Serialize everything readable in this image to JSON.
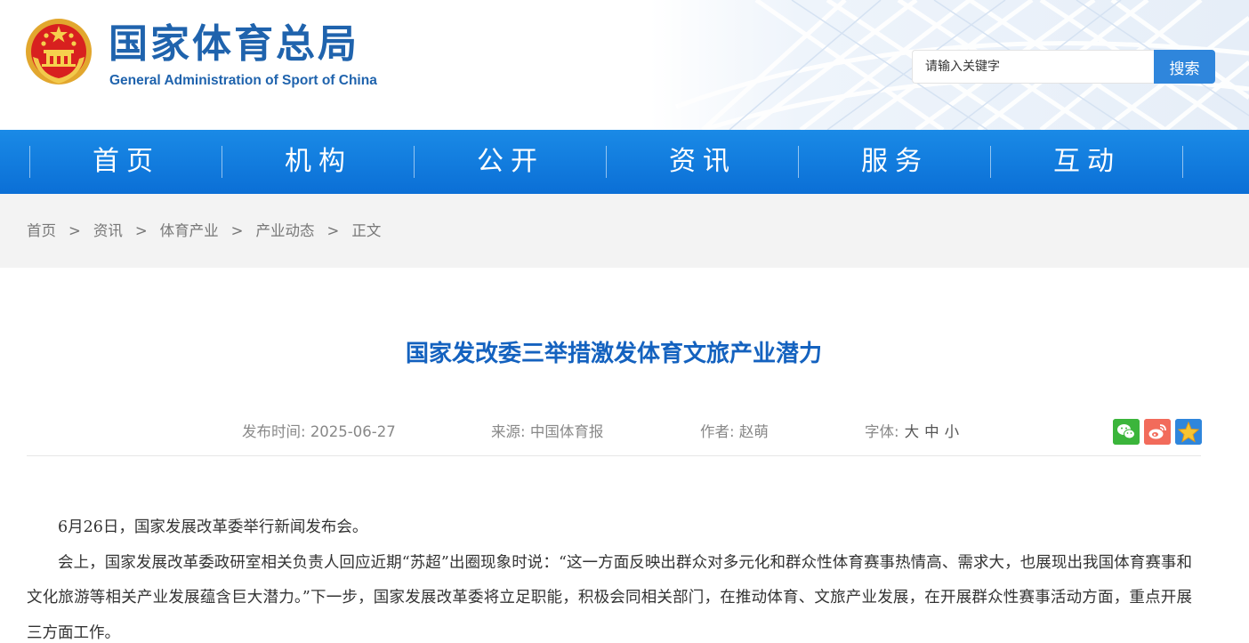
{
  "header": {
    "logo_cn": "国家体育总局",
    "logo_en": "General Administration of Sport of China",
    "search_placeholder": "请输入关键字",
    "search_button": "搜索"
  },
  "nav": {
    "items": [
      {
        "label": "首页"
      },
      {
        "label": "机构"
      },
      {
        "label": "公开"
      },
      {
        "label": "资讯"
      },
      {
        "label": "服务"
      },
      {
        "label": "互动"
      }
    ]
  },
  "breadcrumb": {
    "items": [
      "首页",
      "资讯",
      "体育产业",
      "产业动态",
      "正文"
    ],
    "separator": ">"
  },
  "article": {
    "title": "国家发改委三举措激发体育文旅产业潜力",
    "date_label": "发布时间:",
    "date": "2025-06-27",
    "source_label": "来源:",
    "source": "中国体育报",
    "author_label": "作者:",
    "author": "赵萌",
    "font_label": "字体:",
    "font_large": "大",
    "font_medium": "中",
    "font_small": "小",
    "share_icons": [
      "wechat-icon",
      "weibo-icon",
      "favorite-star-icon"
    ],
    "paragraphs": [
      "6月26日，国家发展改革委举行新闻发布会。",
      "会上，国家发展改革委政研室相关负责人回应近期“苏超”出圈现象时说：“这一方面反映出群众对多元化和群众性体育赛事热情高、需求大，也展现出我国体育赛事和文化旅游等相关产业发展蕴含巨大潜力。”下一步，国家发展改革委将立足职能，积极会同相关部门，在推动体育、文旅产业发展，在开展群众性赛事活动方面，重点开展三方面工作。"
    ]
  },
  "colors": {
    "brand_blue": "#1f63ad",
    "nav_blue": "#0b6fd6",
    "title_blue": "#1462bf",
    "search_button": "#2f86dc",
    "wechat_green": "#3bb53b",
    "weibo_red": "#f26b5b"
  }
}
